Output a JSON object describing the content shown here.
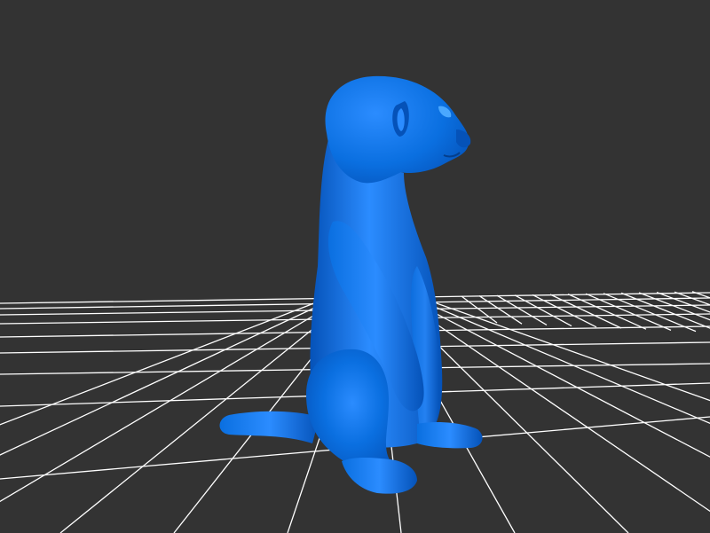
{
  "viewport": {
    "background_color": "#333333",
    "grid_color": "#ffffff",
    "grid_visible": true
  },
  "model": {
    "color": "#0a6fe0",
    "highlight_color": "#2b8cff",
    "shadow_color": "#0552b8",
    "icon": "meerkat-figure"
  }
}
